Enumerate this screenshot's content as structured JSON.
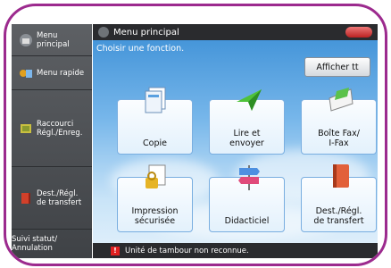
{
  "sidebar": {
    "items": [
      {
        "label": "Menu\nprincipal",
        "icon": "home-icon"
      },
      {
        "label": "Menu rapide",
        "icon": "quick-menu-icon"
      },
      {
        "label": "Raccourci\nRégl./Enreg.",
        "icon": "shortcut-icon"
      },
      {
        "label": "Dest./Régl.\nde transfert",
        "icon": "book-icon"
      },
      {
        "label": "Suivi statut/\nAnnulation",
        "icon": "status-icon"
      }
    ]
  },
  "header": {
    "title": "Menu principal",
    "home_icon": "home-icon"
  },
  "main": {
    "instruction": "Choisir une fonction.",
    "show_all_label": "Afficher tt",
    "tiles": [
      {
        "label": "Copie",
        "icon": "copy-icon"
      },
      {
        "label": "Lire et\nenvoyer",
        "icon": "scan-send-icon"
      },
      {
        "label": "Boîte Fax/\nI-Fax",
        "icon": "fax-box-icon"
      },
      {
        "label": "Impression\nsécurisée",
        "icon": "secure-print-icon"
      },
      {
        "label": "Didacticiel",
        "icon": "tutorial-icon"
      },
      {
        "label": "Dest./Régl.\nde transfert",
        "icon": "address-book-icon"
      }
    ]
  },
  "status": {
    "message": "Unité de tambour non reconnue."
  },
  "colors": {
    "frame": "#9c2a8e",
    "bar": "#2a2b2e",
    "tile_border": "#79aee0",
    "warning": "#e02020"
  }
}
